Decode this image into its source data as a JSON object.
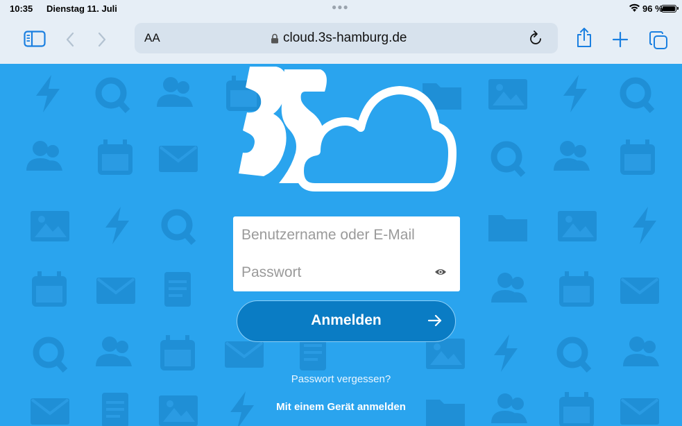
{
  "status_bar": {
    "time": "10:35",
    "date": "Dienstag 11. Juli",
    "battery": "96 %"
  },
  "toolbar": {
    "text_size_label": "AA",
    "url": "cloud.3s-hamburg.de",
    "icons": [
      "sidebar-icon",
      "back-chevron-icon",
      "forward-chevron-icon",
      "lock-icon",
      "reload-icon",
      "share-icon",
      "new-tab-plus-icon",
      "tabs-icon"
    ]
  },
  "login": {
    "username_placeholder": "Benutzername oder E-Mail",
    "password_placeholder": "Passwort",
    "submit_label": "Anmelden",
    "forgot_password": "Passwort vergessen?",
    "device_login": "Mit einem Gerät anmelden"
  },
  "colors": {
    "background": "#2aa4ee",
    "button": "#0a7cc4",
    "chrome": "#e6eef6"
  }
}
